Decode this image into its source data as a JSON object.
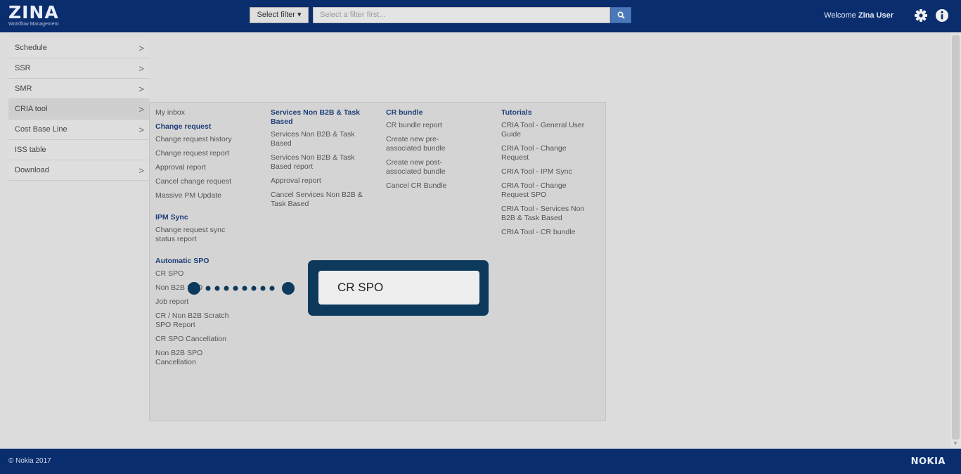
{
  "header": {
    "logo_main": "ZINA",
    "logo_sub": "Workflow Management",
    "filter_button": "Select filter ▾",
    "filter_placeholder": "Select a filter first...",
    "welcome_prefix": "Welcome ",
    "welcome_user": "Zina User"
  },
  "sidebar": {
    "items": [
      {
        "label": "Schedule",
        "chevron": ">"
      },
      {
        "label": "SSR",
        "chevron": ">"
      },
      {
        "label": "SMR",
        "chevron": ">"
      },
      {
        "label": "CRIA tool",
        "chevron": ">"
      },
      {
        "label": "Cost Base Line",
        "chevron": ">"
      },
      {
        "label": "ISS table",
        "chevron": ""
      },
      {
        "label": "Download",
        "chevron": ">"
      }
    ]
  },
  "menu": {
    "col1": {
      "my_inbox": "My inbox",
      "change_request_head": "Change request",
      "change_request_links": [
        "Change request history",
        "Change request report",
        "Approval report",
        "Cancel change request",
        "Massive PM Update"
      ],
      "ipm_sync_head": "IPM Sync",
      "ipm_sync_links": [
        "Change request sync status report"
      ],
      "automatic_spo_head": "Automatic SPO",
      "automatic_spo_links": [
        "CR SPO",
        "Non B2B SPO",
        "Job report",
        "CR / Non B2B Scratch SPO Report",
        "CR SPO Cancellation",
        "Non B2B SPO Cancellation"
      ]
    },
    "col2": {
      "head": "Services Non B2B & Task Based",
      "links": [
        "Services Non B2B & Task Based",
        "Services Non B2B & Task Based report",
        "Approval report",
        "Cancel Services Non B2B & Task Based"
      ]
    },
    "col3": {
      "head": "CR bundle",
      "links": [
        "CR bundle report",
        "Create new pre-associated bundle",
        "Create new post-associated bundle",
        "Cancel CR Bundle"
      ]
    },
    "col4": {
      "head": "Tutorials",
      "links": [
        "CRIA Tool - General User Guide",
        "CRIA Tool - Change Request",
        "CRIA Tool - IPM Sync",
        "CRIA Tool - Change Request SPO",
        "CRIA Tool - Services Non B2B & Task Based",
        "CRIA Tool - CR bundle"
      ]
    }
  },
  "callout": {
    "text": "CR SPO"
  },
  "footer": {
    "copyright": "© Nokia 2017",
    "brand": "NOKIA"
  },
  "colors": {
    "header_bg": "#0a2d6e",
    "menu_heading": "#1d3f78",
    "callout_bg": "#0d3a5c"
  }
}
